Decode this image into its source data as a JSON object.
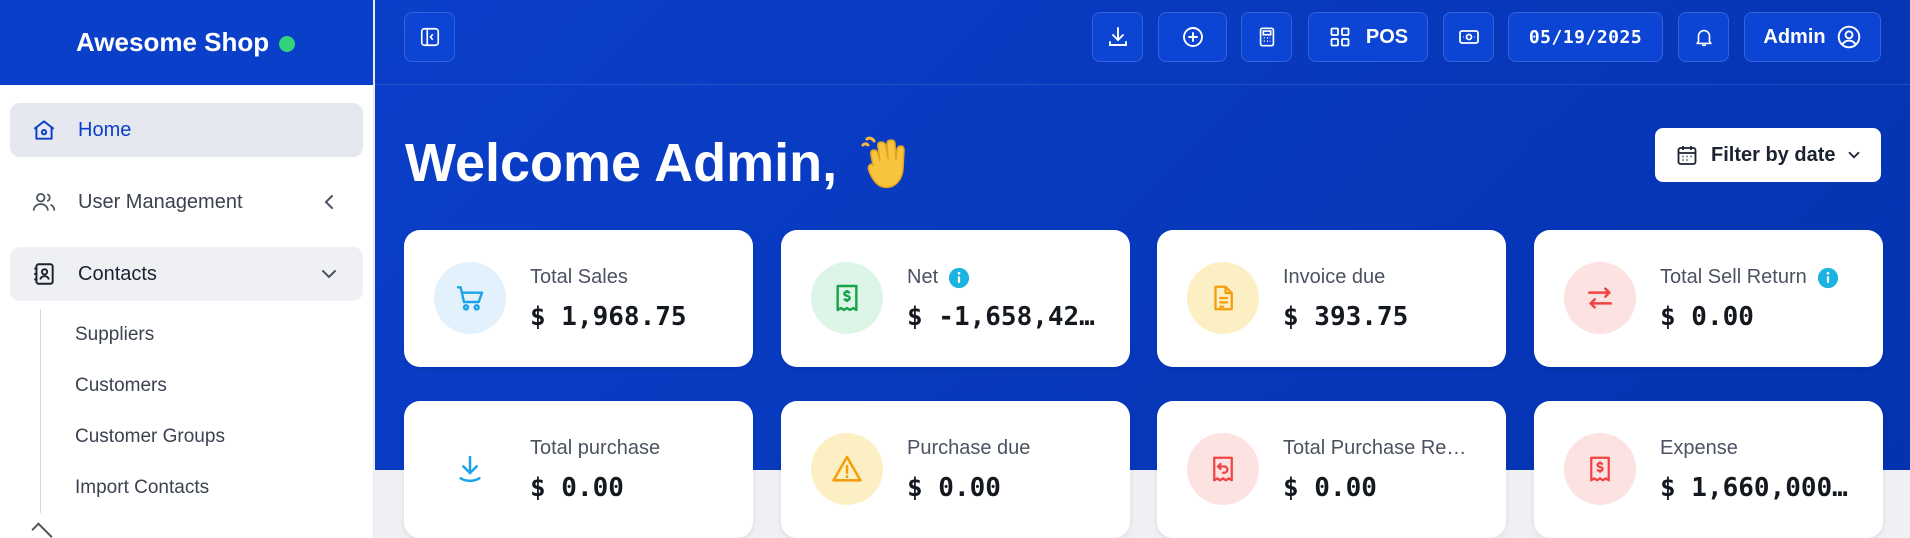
{
  "brand": {
    "name": "Awesome Shop",
    "status_color": "#34d27b"
  },
  "sidebar": {
    "items": [
      {
        "label": "Home",
        "icon": "home-icon",
        "active": true
      },
      {
        "label": "User Management",
        "icon": "users-icon",
        "expandable": true
      },
      {
        "label": "Contacts",
        "icon": "contacts-icon",
        "expanded": true
      }
    ],
    "contacts_submenu": [
      "Suppliers",
      "Customers",
      "Customer Groups",
      "Import Contacts"
    ]
  },
  "topbar": {
    "pos_label": "POS",
    "date": "05/19/2025",
    "user_label": "Admin",
    "icons": [
      "sidebar-toggle-icon",
      "download-icon",
      "add-circle-icon",
      "calculator-icon",
      "grid-icon",
      "cash-icon",
      "bell-icon",
      "user-circle-icon"
    ]
  },
  "header": {
    "welcome": "Welcome Admin,",
    "wave_icon": "waving-hand-icon",
    "filter_label": "Filter by date"
  },
  "cards": [
    {
      "label": "Total Sales",
      "value": "$ 1,968.75",
      "icon": "cart-icon",
      "info": false,
      "bg": "#e3f1fc",
      "color": "#1aa3e8"
    },
    {
      "label": "Net",
      "value": "$ -1,658,42…",
      "icon": "receipt-dollar-icon",
      "info": true,
      "bg": "#dcf5e6",
      "color": "#16a34a"
    },
    {
      "label": "Invoice due",
      "value": "$ 393.75",
      "icon": "document-icon",
      "info": false,
      "bg": "#fdefc4",
      "color": "#f59e0b"
    },
    {
      "label": "Total Sell Return",
      "value": "$ 0.00",
      "icon": "exchange-icon",
      "info": true,
      "bg": "#fde2e2",
      "color": "#ef4444"
    },
    {
      "label": "Total purchase",
      "value": "$ 0.00",
      "icon": "download-icon",
      "info": false,
      "bg": "#ffffff",
      "color": "#1aa3e8"
    },
    {
      "label": "Purchase due",
      "value": "$ 0.00",
      "icon": "warning-icon",
      "info": false,
      "bg": "#fdefc4",
      "color": "#f59e0b"
    },
    {
      "label": "Total Purchase Re…",
      "value": "$ 0.00",
      "icon": "receipt-return-icon",
      "info": false,
      "bg": "#fde2e2",
      "color": "#ef4444"
    },
    {
      "label": "Expense",
      "value": "$ 1,660,000…",
      "icon": "receipt-dollar-icon",
      "info": false,
      "bg": "#fde2e2",
      "color": "#ef4444"
    }
  ],
  "colors": {
    "primary": "#0a3fc9",
    "info": "#1bb3e0"
  }
}
